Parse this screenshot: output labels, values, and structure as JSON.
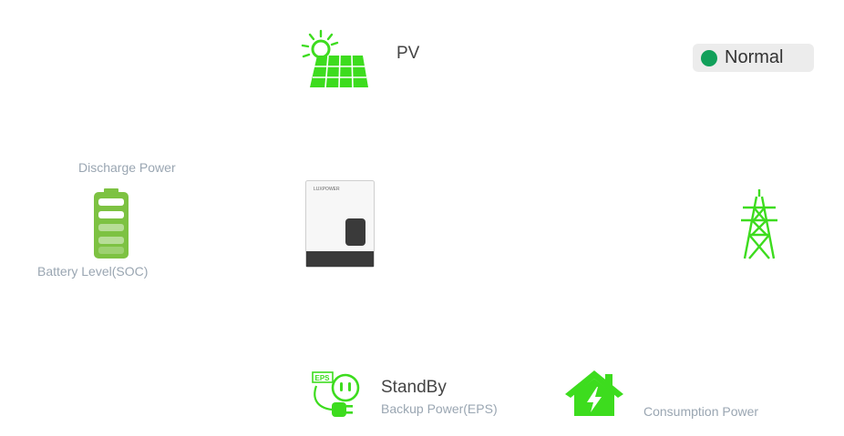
{
  "pv": {
    "label": "PV",
    "icon": "solar-panel-icon"
  },
  "status": {
    "text": "Normal",
    "dot_color": "#11a05a"
  },
  "battery": {
    "discharge_label": "Discharge Power",
    "soc_label": "Battery Level(SOC)",
    "icon": "battery-icon",
    "color": "#7dc242"
  },
  "inverter": {
    "brand": "LUXPOWER",
    "icon": "inverter-icon"
  },
  "grid": {
    "icon": "power-tower-icon",
    "color": "#3ddc1e"
  },
  "eps": {
    "state": "StandBy",
    "label": "Backup Power(EPS)",
    "icon": "eps-plug-icon",
    "badge_text": "EPS"
  },
  "consumption": {
    "label": "Consumption Power",
    "icon": "house-icon"
  },
  "accent": "#3ddc1e"
}
